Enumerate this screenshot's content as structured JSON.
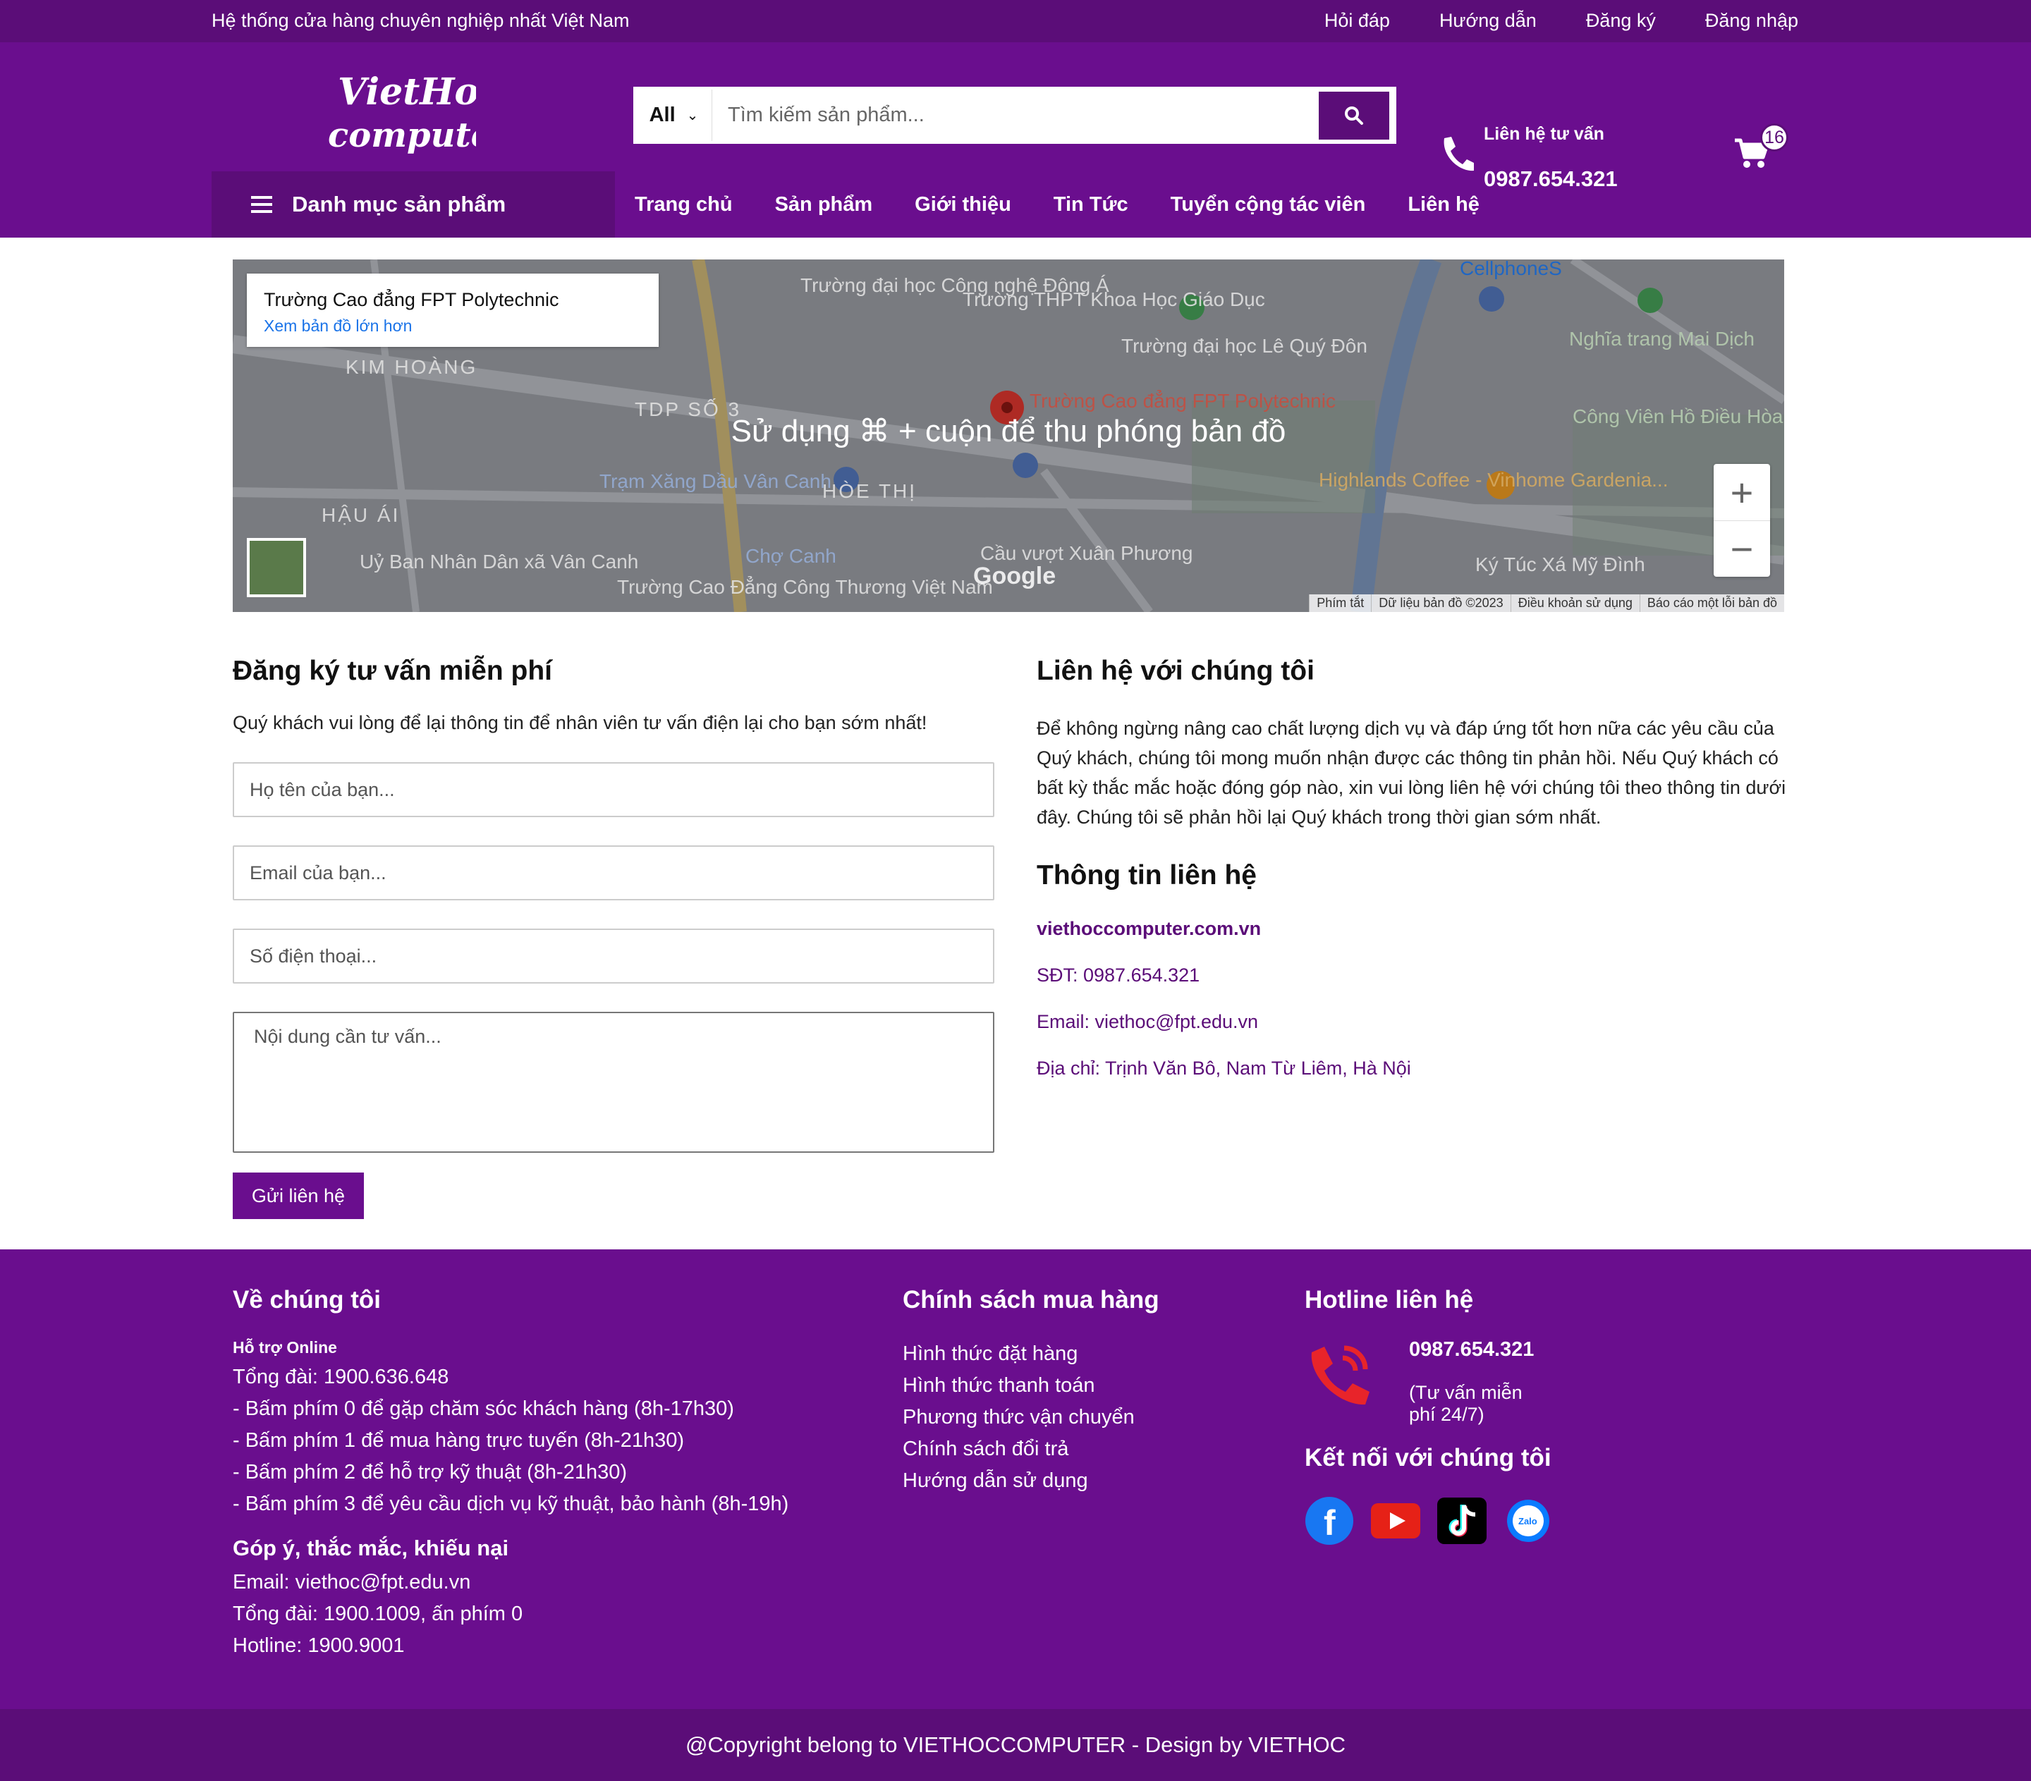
{
  "topbar": {
    "slogan": "Hệ thống cửa hàng chuyên nghiệp nhất Việt Nam",
    "links": [
      "Hỏi đáp",
      "Hướng dẫn",
      "Đăng ký",
      "Đăng nhập"
    ]
  },
  "header": {
    "logo_line1": "VietHoc",
    "logo_line2": "computer",
    "search": {
      "category": "All",
      "placeholder": "Tìm kiếm sản phẩm..."
    },
    "hotline": {
      "label": "Liên hệ tư vấn",
      "number": "0987.654.321"
    },
    "cart_count": "16"
  },
  "nav": {
    "category_menu": "Danh mục sản phẩm",
    "items": [
      "Trang chủ",
      "Sản phẩm",
      "Giới thiệu",
      "Tin Tức",
      "Tuyển cộng tác viên",
      "Liên hệ"
    ]
  },
  "map": {
    "place_title": "Trường Cao đẳng FPT Polytechnic",
    "place_link": "Xem bản đồ lớn hơn",
    "overlay_hint": "Sử dụng ⌘ + cuộn để thu phóng bản đồ",
    "zoom_in": "+",
    "zoom_out": "−",
    "google": "Google",
    "attribution": [
      "Phím tắt",
      "Dữ liệu bản đồ ©2023",
      "Điều khoản sử dụng",
      "Báo cáo một lỗi bản đồ"
    ],
    "labels": {
      "kim_hoang": "KIM HOÀNG",
      "tdp": "TDP SỐ 3",
      "hau_ai": "HẬU ÁI",
      "hoe_thi": "HÒE THỊ",
      "cellphones": "CellphoneS",
      "nghia_trang": "Nghĩa trang Mai Dịch",
      "highlands": "Highlands Coffee - Vinhome Gardenia...",
      "cho_canh": "Chợ Canh",
      "cau_vuot": "Cầu vượt Xuân Phương",
      "ktx": "Ký Túc Xá Mỹ Đình",
      "marker": "Trường Cao đẳng FPT Polytechnic",
      "tram_xang": "Trạm Xăng Dầu Vân Canh",
      "ubnd": "Uỷ Ban Nhân Dân xã Vân Canh",
      "thpt": "Trường THPT Khoa Học Giáo Dục",
      "le_quy_don": "Trường đại học Lê Quý Đôn",
      "cong_nghe": "Trường đại học Công nghệ Đông Á",
      "cd_cong_thuong": "Trường Cao Đẳng Công Thương Việt Nam",
      "cong_vien": "Công Viên Hồ Điều Hòa Mai Dịch"
    }
  },
  "form": {
    "title": "Đăng ký tư vấn miễn phí",
    "intro": "Quý khách vui lòng để lại thông tin để nhân viên tư vấn điện lại cho bạn sớm nhất!",
    "name_placeholder": "Họ tên của bạn...",
    "email_placeholder": "Email của bạn...",
    "phone_placeholder": "Số điện thoại...",
    "content_placeholder": "Nội dung cần tư vấn...",
    "submit": "Gửi liên hệ"
  },
  "contact": {
    "title": "Liên hệ với chúng tôi",
    "desc": "Để không ngừng nâng cao chất lượng dịch vụ và đáp ứng tốt hơn nữa các yêu cầu của Quý khách, chúng tôi mong muốn nhận được các thông tin phản hồi. Nếu Quý khách có bất kỳ thắc mắc hoặc đóng góp nào, xin vui lòng liên hệ với chúng tôi theo thông tin dưới đây. Chúng tôi sẽ phản hồi lại Quý khách trong thời gian sớm nhất.",
    "info_title": "Thông tin liên hệ",
    "site": "viethoccomputer.com.vn",
    "phone": "SĐT: 0987.654.321",
    "email": "Email: viethoc@fpt.edu.vn",
    "address": "Địa chỉ: Trịnh Văn Bô, Nam Từ Liêm, Hà Nội"
  },
  "footer": {
    "about": {
      "title": "Về chúng tôi",
      "support": "Hỗ trợ Online",
      "lines": [
        "Tổng đài: 1900.636.648",
        "- Bấm phím 0 để gặp chăm sóc khách hàng (8h-17h30)",
        "- Bấm phím 1 để mua hàng trực tuyến (8h-21h30)",
        "- Bấm phím 2 để hỗ trợ kỹ thuật (8h-21h30)",
        "- Bấm phím 3 để yêu cầu dịch vụ kỹ thuật, bảo hành (8h-19h)"
      ],
      "feedback_title": "Góp ý, thắc mắc, khiếu nại",
      "feedback_lines": [
        "Email: viethoc@fpt.edu.vn",
        "Tổng đài: 1900.1009, ấn phím 0",
        "Hotline: 1900.9001"
      ]
    },
    "policy": {
      "title": "Chính sách mua hàng",
      "links": [
        "Hình thức đặt hàng",
        "Hình thức thanh toán",
        "Phương thức vận chuyển",
        "Chính sách đổi trả",
        "Hướng dẫn sử dụng"
      ]
    },
    "hotline": {
      "title": "Hotline liên hệ",
      "number": "0987.654.321",
      "note": "(Tư vấn miễn phí 24/7)",
      "connect_title": "Kết nối với chúng tôi",
      "social": [
        "facebook-icon",
        "youtube-icon",
        "tiktok-icon",
        "zalo-icon"
      ]
    }
  },
  "copyright": "@Copyright belong to VIETHOCCOMPUTER - Design by VIETHOC",
  "colors": {
    "brand": "#6a0e8e",
    "brand_dark": "#5b0d78",
    "link": "#5b0d78"
  }
}
